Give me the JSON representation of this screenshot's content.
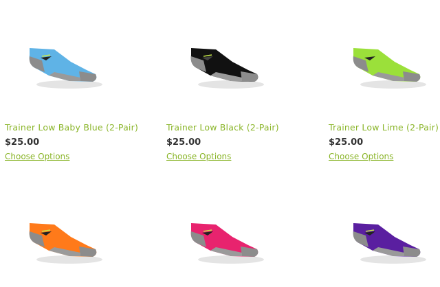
{
  "theme": {
    "link_color": "#8ab529",
    "price_color": "#333333"
  },
  "products": [
    {
      "name": "Trainer Low Baby Blue (2-Pair)",
      "price": "$25.00",
      "action": "Choose Options",
      "color": "#5fb3e6",
      "icon": "sock-image"
    },
    {
      "name": "Trainer Low Black (2-Pair)",
      "price": "$25.00",
      "action": "Choose Options",
      "color": "#111111",
      "icon": "sock-image"
    },
    {
      "name": "Trainer Low Lime (2-Pair)",
      "price": "$25.00",
      "action": "Choose Options",
      "color": "#9be03a",
      "icon": "sock-image"
    },
    {
      "color": "#ff7a1a",
      "icon": "sock-image"
    },
    {
      "color": "#e8236e",
      "icon": "sock-image"
    },
    {
      "color": "#5a1fa0",
      "icon": "sock-image"
    }
  ]
}
